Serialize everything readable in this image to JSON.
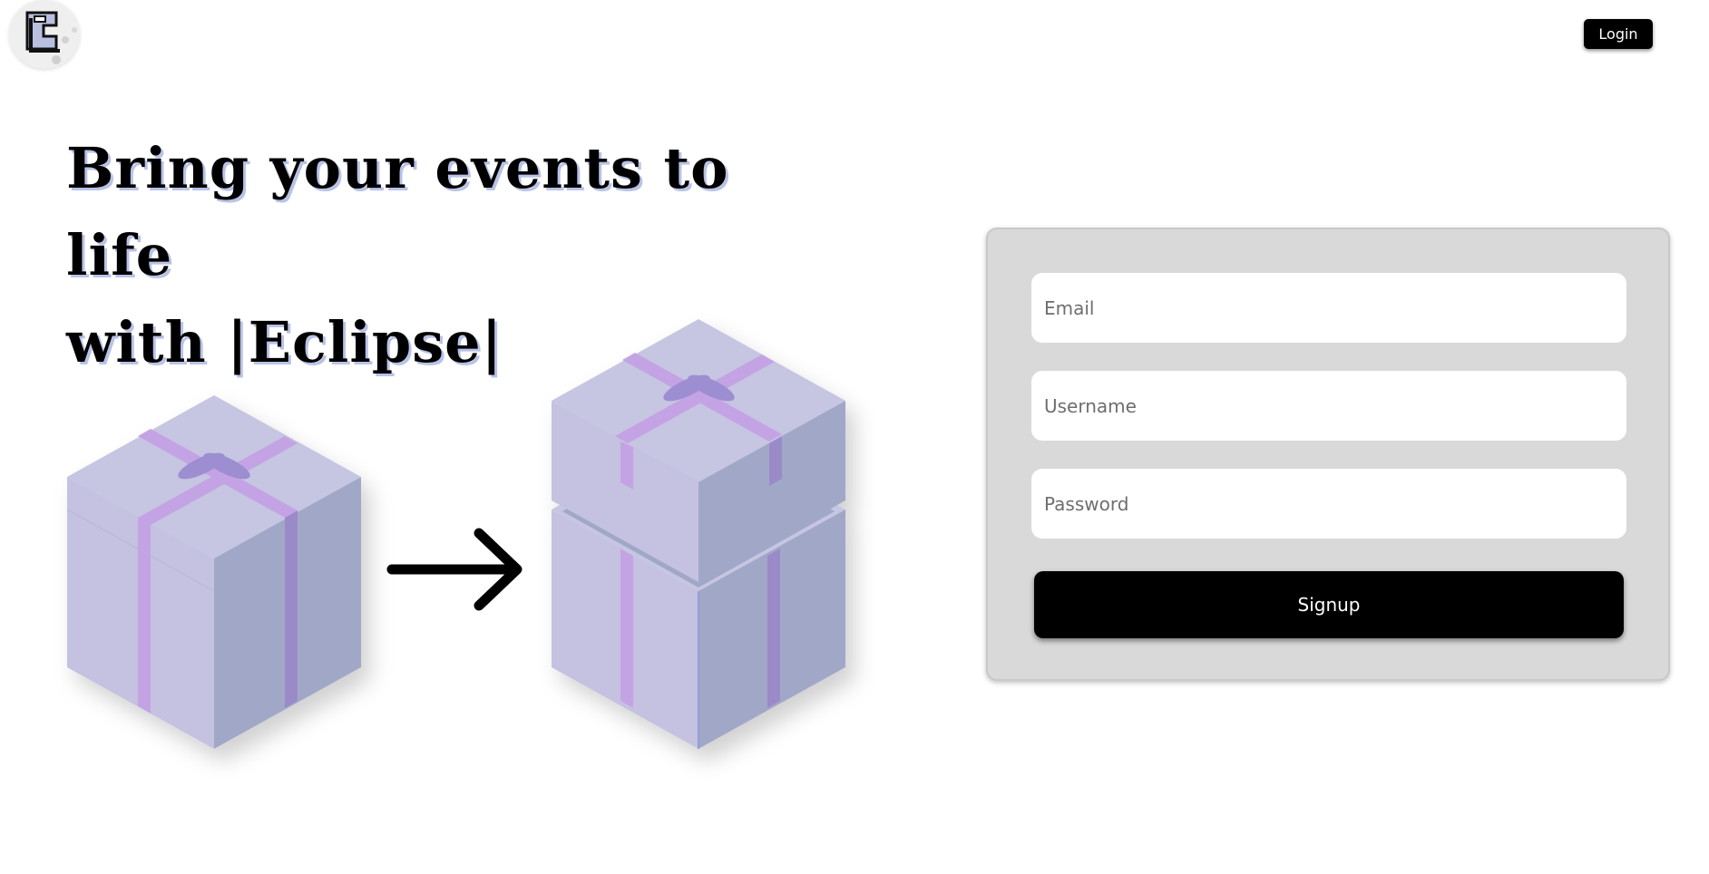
{
  "header": {
    "logo_letter": "E",
    "login_label": "Login"
  },
  "hero": {
    "title_line1": "Bring your events to life",
    "title_line2": "with |Eclipse|"
  },
  "illustration": {
    "box_colors": {
      "top": "#c6c5e2",
      "left": "#c4c2e0",
      "right": "#a1a8c7",
      "ribbon": "#c4a3e4",
      "ribbon_dark": "#9b8ac8",
      "bow": "#9d8ed2"
    }
  },
  "signup_form": {
    "email_placeholder": "Email",
    "username_placeholder": "Username",
    "password_placeholder": "Password",
    "submit_label": "Signup"
  },
  "colors": {
    "panel_bg": "#d9d9d9",
    "button_bg": "#000000",
    "title_shadow": "#b9c2e6"
  }
}
